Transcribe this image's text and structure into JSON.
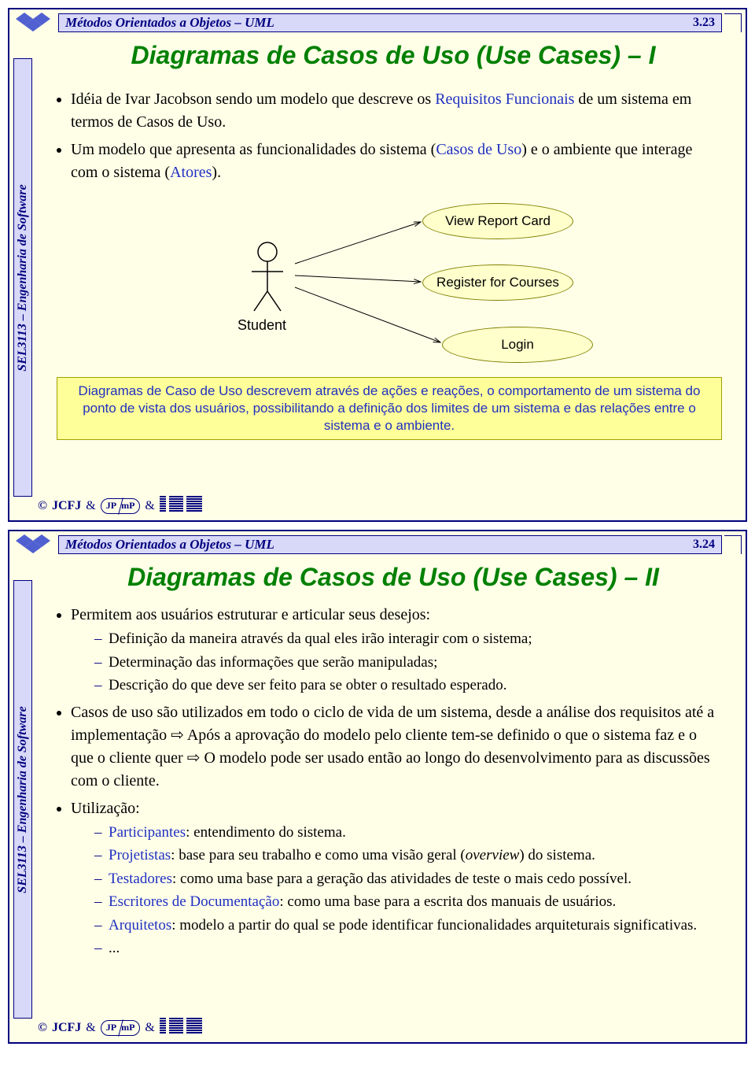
{
  "course_code": "SEL3113 – Engenharia de Software",
  "course_topic": "Métodos Orientados a Objetos – UML",
  "footer": {
    "author": "JCFJ",
    "pill_left": "JP",
    "pill_right": "mP"
  },
  "slide1": {
    "page": "3.23",
    "title": "Diagramas de Casos de Uso (Use Cases) – I",
    "bullet1_a": "Idéia de Ivar Jacobson sendo um modelo que descreve os ",
    "bullet1_link": "Requisitos Funcionais",
    "bullet1_b": " de um sistema em termos de Casos de Uso.",
    "bullet2_a": "Um modelo que apresenta as funcionalidades do sistema (",
    "bullet2_link1": "Casos de Uso",
    "bullet2_b": ") e o ambiente que interage com o sistema (",
    "bullet2_link2": "Atores",
    "bullet2_c": ").",
    "diagram": {
      "actor": "Student",
      "uc1": "View Report Card",
      "uc2": "Register for Courses",
      "uc3": "Login"
    },
    "note": "Diagramas de Caso de Uso descrevem através de ações e reações, o comportamento de um sistema do ponto de vista dos usuários, possibilitando a definição dos limites de um sistema e das relações entre o sistema e o ambiente."
  },
  "slide2": {
    "page": "3.24",
    "title": "Diagramas de Casos de Uso (Use Cases) – II",
    "b1": "Permitem aos usuários estruturar e articular seus desejos:",
    "b1_s1": "Definição da maneira através da qual eles irão interagir com o sistema;",
    "b1_s2": "Determinação das informações que serão manipuladas;",
    "b1_s3": "Descrição do que deve ser feito para se obter o resultado esperado.",
    "b2_a": "Casos de uso são utilizados em todo o ciclo de vida de um sistema, desde a análise dos requisitos até a implementação ",
    "b2_arrow": "⇨",
    "b2_b": " Após a aprovação do modelo pelo cliente tem-se definido o que o sistema faz e o que o cliente quer ",
    "b2_c": " O modelo pode ser usado então ao longo do desenvolvimento para as discussões com o cliente.",
    "b3": "Utilização:",
    "b3_s1_k": "Participantes",
    "b3_s1_v": ": entendimento do sistema.",
    "b3_s2_k": "Projetistas",
    "b3_s2_v_a": ": base para seu trabalho e como uma visão geral (",
    "b3_s2_ov": "overview",
    "b3_s2_v_b": ") do sistema.",
    "b3_s3_k": "Testadores",
    "b3_s3_v": ": como uma base para a geração das atividades de teste o mais cedo possível.",
    "b3_s4_k": "Escritores de Documentação",
    "b3_s4_v": ": como uma base para a escrita dos manuais de usuários.",
    "b3_s5_k": "Arquitetos",
    "b3_s5_v": ": modelo a partir do qual se pode identificar funcionalidades arquiteturais significativas.",
    "b3_s6": "..."
  }
}
